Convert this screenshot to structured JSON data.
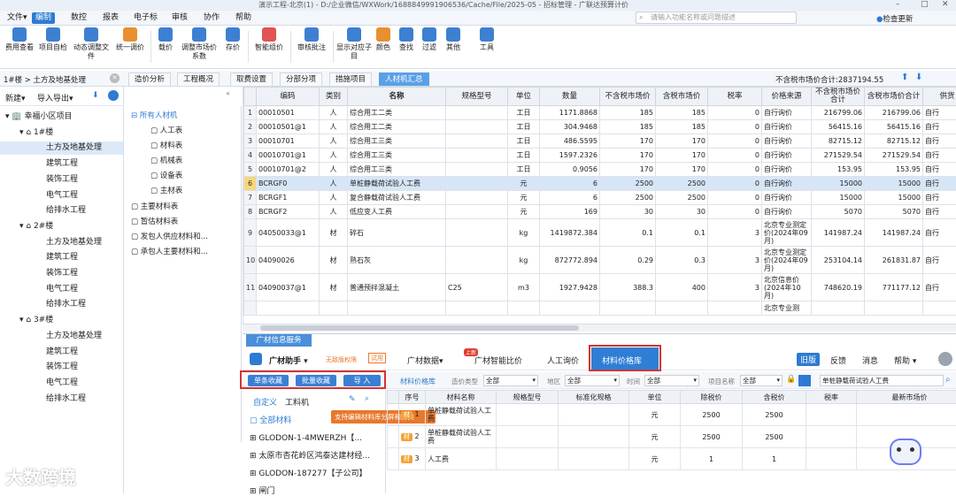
{
  "titlebar": {
    "title": "演示工程-北京(1) - D:/企业微信/WXWork/1688849991906536/Cache/File/2025-05 - 招标管理 - 广联达预算计价",
    "minimize": "–",
    "maximize": "□",
    "close": "✕"
  },
  "menu": [
    "文件▾",
    "编制",
    "数控",
    "报表",
    "电子标",
    "审核",
    "协作",
    "帮助"
  ],
  "search": {
    "placeholder": "请输入功能名称或问题描述"
  },
  "topright": {
    "check_update": "检查更新"
  },
  "ribbon": [
    "费用查看",
    "项目自检",
    "动态调整文件",
    "统一调价",
    "载价",
    "调整市场价系数",
    "存价",
    "智能组价",
    "审核批注",
    "显示对应子目",
    "颜色",
    "查找",
    "过滤",
    "其他",
    "工具"
  ],
  "breadcrumb": "1#楼 > 土方及地基处理",
  "tabs": [
    "造价分析",
    "工程概况",
    "取费设置",
    "分部分项",
    "措施项目",
    "人材机汇总"
  ],
  "total": {
    "label": "不含税市场价合计:2837194.55"
  },
  "lefttool": {
    "new": "新建▾",
    "import_export": "导入导出▾"
  },
  "tree": [
    {
      "label": "幸福小区项目",
      "level": 0
    },
    {
      "label": "1#楼",
      "level": 1
    },
    {
      "label": "土方及地基处理",
      "level": 2
    },
    {
      "label": "建筑工程",
      "level": 2
    },
    {
      "label": "装饰工程",
      "level": 2
    },
    {
      "label": "电气工程",
      "level": 2
    },
    {
      "label": "给排水工程",
      "level": 2
    },
    {
      "label": "2#楼",
      "level": 1
    },
    {
      "label": "土方及地基处理",
      "level": 2
    },
    {
      "label": "建筑工程",
      "level": 2
    },
    {
      "label": "装饰工程",
      "level": 2
    },
    {
      "label": "电气工程",
      "level": 2
    },
    {
      "label": "给排水工程",
      "level": 2
    },
    {
      "label": "3#楼",
      "level": 1
    },
    {
      "label": "土方及地基处理",
      "level": 2
    },
    {
      "label": "建筑工程",
      "level": 2
    },
    {
      "label": "装饰工程",
      "level": 2
    },
    {
      "label": "电气工程",
      "level": 2
    },
    {
      "label": "给排水工程",
      "level": 2
    }
  ],
  "categories": [
    "所有人材机",
    "人工表",
    "材料表",
    "机械表",
    "设备表",
    "主材表",
    "主要材料表",
    "暂估材料表",
    "发包人供应材料和...",
    "承包人主要材料和..."
  ],
  "grid": {
    "headers": [
      "",
      "编码",
      "类别",
      "名称",
      "规格型号",
      "单位",
      "数量",
      "不含税市场价",
      "含税市场价",
      "税率",
      "价格来源",
      "不含税市场价合计",
      "含税市场价合计",
      "供货"
    ],
    "rows": [
      [
        "1",
        "00010501",
        "人",
        "综合用工二类",
        "",
        "工日",
        "1171.8868",
        "185",
        "185",
        "0",
        "自行询价",
        "216799.06",
        "216799.06",
        "自行"
      ],
      [
        "2",
        "00010501@1",
        "人",
        "综合用工二类",
        "",
        "工日",
        "304.9468",
        "185",
        "185",
        "0",
        "自行询价",
        "56415.16",
        "56415.16",
        "自行"
      ],
      [
        "3",
        "00010701",
        "人",
        "综合用工三类",
        "",
        "工日",
        "486.5595",
        "170",
        "170",
        "0",
        "自行询价",
        "82715.12",
        "82715.12",
        "自行"
      ],
      [
        "4",
        "00010701@1",
        "人",
        "综合用工三类",
        "",
        "工日",
        "1597.2326",
        "170",
        "170",
        "0",
        "自行询价",
        "271529.54",
        "271529.54",
        "自行"
      ],
      [
        "5",
        "00010701@2",
        "人",
        "综合用工三类",
        "",
        "工日",
        "0.9056",
        "170",
        "170",
        "0",
        "自行询价",
        "153.95",
        "153.95",
        "自行"
      ],
      [
        "6",
        "BCRGF0",
        "人",
        "单桩静载荷试验人工费",
        "",
        "元",
        "6",
        "2500",
        "2500",
        "0",
        "自行询价",
        "15000",
        "15000",
        "自行"
      ],
      [
        "7",
        "BCRGF1",
        "人",
        "复合静载荷试验人工费",
        "",
        "元",
        "6",
        "2500",
        "2500",
        "0",
        "自行询价",
        "15000",
        "15000",
        "自行"
      ],
      [
        "8",
        "BCRGF2",
        "人",
        "低应变人工费",
        "",
        "元",
        "169",
        "30",
        "30",
        "0",
        "自行询价",
        "5070",
        "5070",
        "自行"
      ],
      [
        "9",
        "04050033@1",
        "材",
        "碎石",
        "",
        "kg",
        "1419872.384",
        "0.1",
        "0.1",
        "3",
        "北京专业测定价(2024年09月)",
        "141987.24",
        "141987.24",
        "自行"
      ],
      [
        "10",
        "04090026",
        "材",
        "熟石灰",
        "",
        "kg",
        "872772.894",
        "0.29",
        "0.3",
        "3",
        "北京专业测定价(2024年09月)",
        "253104.14",
        "261831.87",
        "自行"
      ],
      [
        "11",
        "04090037@1",
        "材",
        "普通预拌混凝土",
        "C25",
        "m3",
        "1927.9428",
        "388.3",
        "400",
        "3",
        "北京信息价(2024年10月)",
        "748620.19",
        "771177.12",
        "自行"
      ],
      [
        "",
        "",
        "",
        "",
        "",
        "",
        "",
        "",
        "",
        "",
        "北京专业测",
        "",
        "",
        ""
      ]
    ]
  },
  "bottom": {
    "panel_title": "广材信息服务",
    "assistant": "广材助手 ▾",
    "unlimited": "无敌版权限",
    "trial": "试用",
    "nav": [
      "广材数据▾",
      "广材智能比价",
      "人工询价",
      "材料价格库"
    ],
    "nav_badge": "上新",
    "old_version": "旧版",
    "links": [
      "反馈",
      "消息",
      "帮助 ▾"
    ],
    "buttons": [
      "单条收藏",
      "批量收藏",
      "导 入"
    ],
    "lib_label": "材料价格库",
    "filters": [
      {
        "label": "造价类型",
        "value": "全部"
      },
      {
        "label": "地区",
        "value": "全部"
      },
      {
        "label": "时间",
        "value": "全部"
      },
      {
        "label": "项目名称",
        "value": "全部"
      }
    ],
    "search_value": "单桩静载荷试验人工费",
    "left_tabs": [
      "自定义",
      "工料机"
    ],
    "left_items": [
      "全部材料",
      "GLODON-1-4MWERZH【...",
      "太原市杏花岭区鸿泰达建材经...",
      "GLODON-187277【子公司】",
      "闸门"
    ],
    "tooltip": "支持编辑材料库分屏和分类",
    "grid_headers": [
      "",
      "序号",
      "材料名称",
      "规格型号",
      "标准化规格",
      "单位",
      "除税价",
      "含税价",
      "税率",
      "最新市场价"
    ],
    "rows": [
      {
        "no": "1",
        "name": "单桩静载荷试验人工费",
        "unit": "元",
        "price": "2500",
        "tax_price": "2500"
      },
      {
        "no": "2",
        "name": "单桩静载荷试验人工费",
        "unit": "元",
        "price": "2500",
        "tax_price": "2500"
      },
      {
        "no": "3",
        "name": "人工费",
        "unit": "元",
        "price": "1",
        "tax_price": "1"
      }
    ],
    "tag": "材"
  },
  "watermark": "大数跨境",
  "colors": {
    "accent": "#2d7bd2",
    "highlight_box": "#d9322f",
    "selected_row": "#d7e6f7"
  }
}
